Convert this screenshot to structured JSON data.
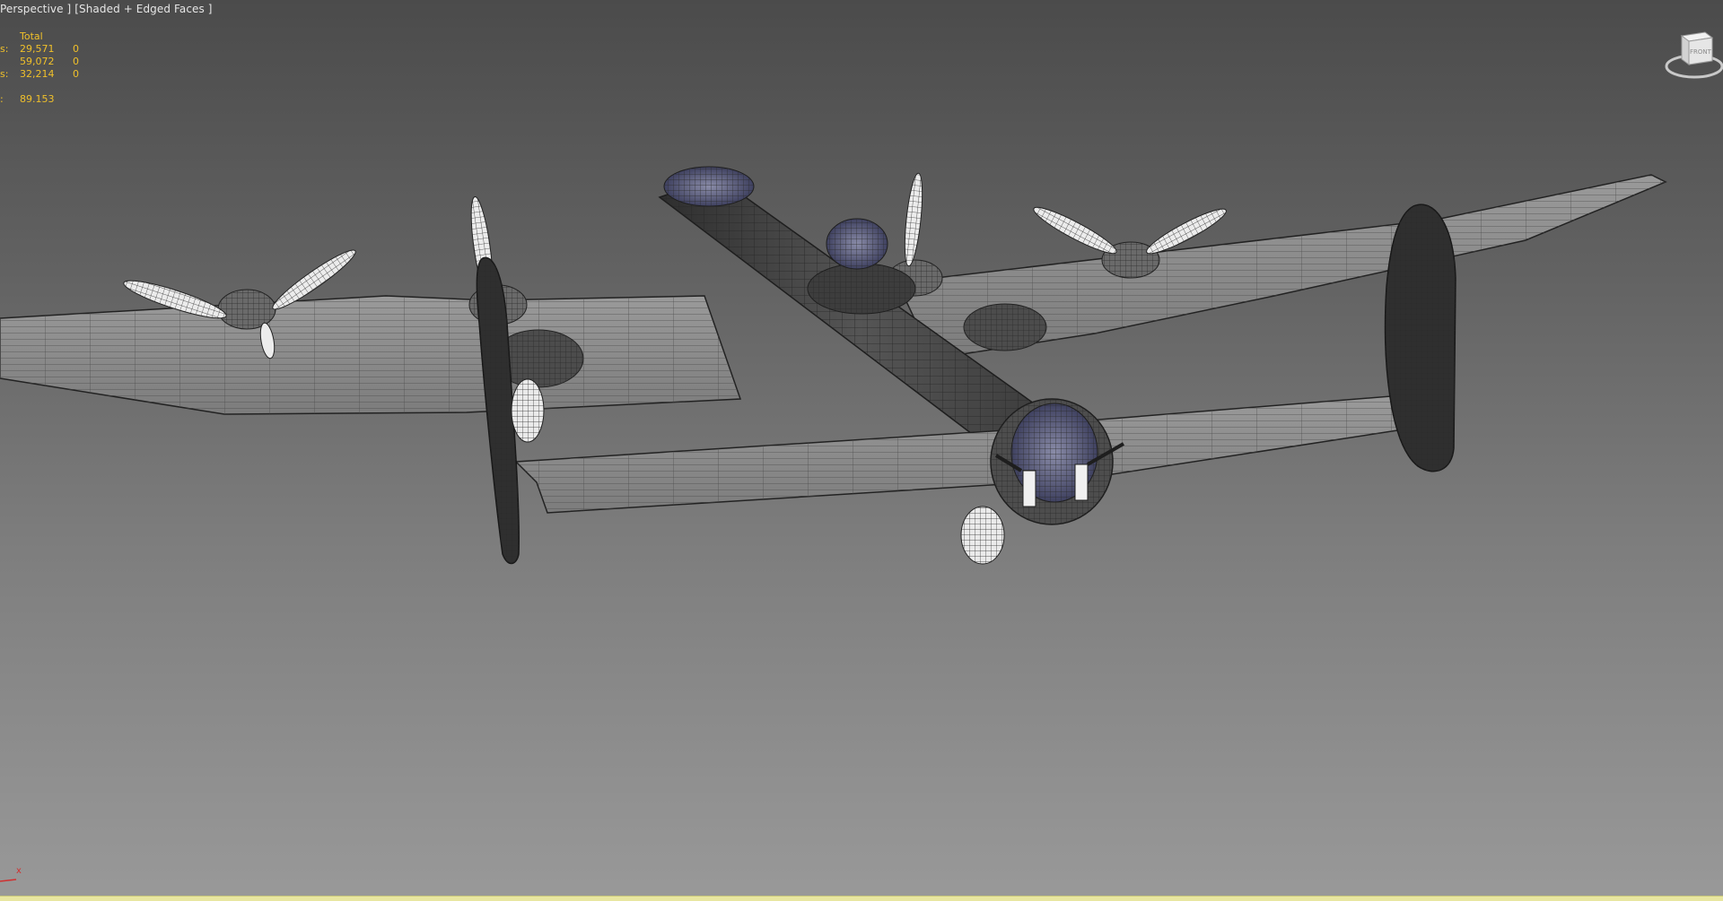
{
  "viewport": {
    "label": "Perspective ] [Shaded + Edged Faces ]"
  },
  "stats": {
    "header": "Total",
    "rows": [
      {
        "label": "s:",
        "total": "29,571",
        "selected": "0"
      },
      {
        "label": "",
        "total": "59,072",
        "selected": "0"
      },
      {
        "label": "s:",
        "total": "32,214",
        "selected": "0"
      }
    ],
    "fps": {
      "label": ":",
      "value": "89.153"
    }
  },
  "viewcube": {
    "icon": "viewcube-icon",
    "face_label": "FRONT"
  },
  "axis": {
    "x_label": "x"
  },
  "colors": {
    "stats_text": "#f0c02a",
    "label_text": "#e6e6e6",
    "timeline": "#e8e6a0",
    "axis_x": "#d03030"
  }
}
